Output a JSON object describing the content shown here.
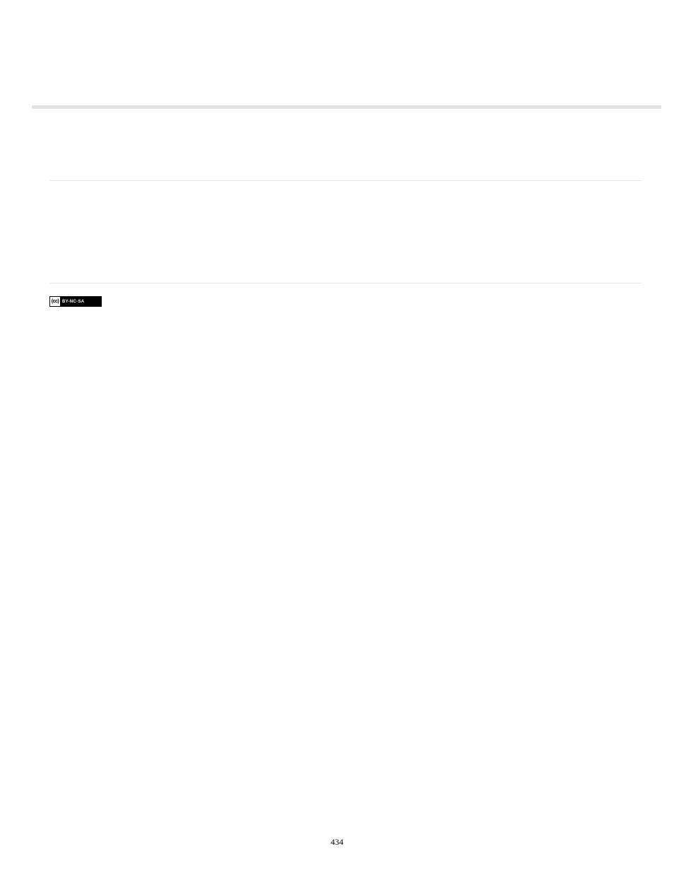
{
  "license_badge": {
    "cc_symbol": "(cc)",
    "text": "BY-NC-SA"
  },
  "page_number": "434"
}
